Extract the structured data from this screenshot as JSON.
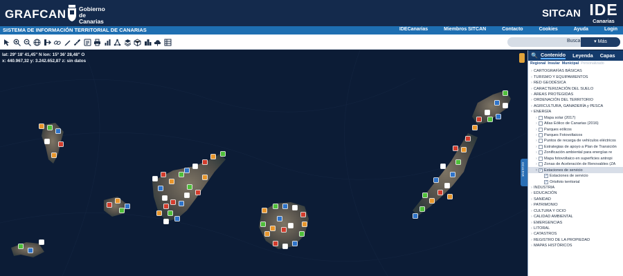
{
  "header": {
    "brand": "GRAFCAN",
    "gov_line1": "Gobierno",
    "gov_line2": "de Canarias",
    "sitcan": "SITCAN",
    "ide_big": "IDE",
    "ide_small": "Canarias"
  },
  "nav": {
    "title": "SISTEMA DE INFORMACIÓN TERRITORIAL DE CANARIAS",
    "links": [
      "IDECanarias",
      "Miembros SITCAN",
      "Contacto",
      "Cookies",
      "Ayuda",
      "Login"
    ]
  },
  "toolbar": {
    "tools": [
      "select-icon",
      "zoom-in-icon",
      "zoom-out-icon",
      "globe-icon",
      "exit-icon",
      "link-icon",
      "draw-icon",
      "measure-icon",
      "info-icon",
      "print-icon",
      "chart-icon",
      "network-icon",
      "layers-icon",
      "cube-icon",
      "city-icon",
      "cloud-icon",
      "table-icon"
    ]
  },
  "search": {
    "button": "Buscar",
    "more": "▾ Más"
  },
  "map": {
    "coord_line1": "lat: 29º 18' 41,45\" N  lon: 15º 36' 28,48\" O",
    "coord_line2": "x: 440.967,32  y: 3.242.652,87  z: sin datos",
    "side_tab": "OCULTAR"
  },
  "panel": {
    "tabs": [
      "Contenido",
      "Leyenda",
      "Capas"
    ],
    "subtabs": [
      "Regional",
      "Insular",
      "Municipal",
      "Personalizado"
    ],
    "tree": [
      {
        "label": "CARTOGRAFÍAS BÁSICAS",
        "level": 0
      },
      {
        "label": "TURISMO Y EQUIPAMIENTOS",
        "level": 0
      },
      {
        "label": "RED GEODÉSICA",
        "level": 0
      },
      {
        "label": "CARACTERIZACIÓN DEL SUELO",
        "level": 0
      },
      {
        "label": "ÁREAS PROTEGIDAS",
        "level": 0
      },
      {
        "label": "ORDENACIÓN DEL TERRITORIO",
        "level": 0
      },
      {
        "label": "AGRICULTURA, GANADERÍA y PESCA",
        "level": 0
      },
      {
        "label": "ENERGÍA",
        "level": 0,
        "open": true
      },
      {
        "label": "Mapa solar (2017)",
        "level": 1
      },
      {
        "label": "Atlas Eólico de Canarias (2016)",
        "level": 1
      },
      {
        "label": "Parques eólicos",
        "level": 1
      },
      {
        "label": "Parques Fotovoltaicos",
        "level": 1
      },
      {
        "label": "Puntos de recarga de vehículos eléctricos",
        "level": 1
      },
      {
        "label": "Estrategias de apoyo a Plan de Transición",
        "level": 1
      },
      {
        "label": "Zonificación ambiental para energías re",
        "level": 1
      },
      {
        "label": "Mapa fotovoltaico en superficies antropi",
        "level": 1
      },
      {
        "label": "Zonas de Aceleración de Renovables (ZA",
        "level": 1
      },
      {
        "label": "Estaciones de servicio",
        "level": 1,
        "checked": true,
        "highlight": true,
        "open": true
      },
      {
        "label": "Estaciones de servicio",
        "level": 2,
        "checked": true
      },
      {
        "label": "Ortofoto territorial",
        "level": 2,
        "checked": true
      },
      {
        "label": "INDUSTRIA",
        "level": 0
      },
      {
        "label": "EDUCACIÓN",
        "level": 0
      },
      {
        "label": "SANIDAD",
        "level": 0
      },
      {
        "label": "PATRIMONIO",
        "level": 0
      },
      {
        "label": "CULTURA Y OCIO",
        "level": 0
      },
      {
        "label": "CALIDAD AMBIENTAL",
        "level": 0
      },
      {
        "label": "EMERGENCIAS",
        "level": 0
      },
      {
        "label": "LITORAL",
        "level": 0
      },
      {
        "label": "CATASTROS",
        "level": 0
      },
      {
        "label": "REGISTRO DE LA PROPIEDAD",
        "level": 0
      },
      {
        "label": "MAPAS HISTÓRICOS",
        "level": 0
      }
    ]
  },
  "colors": {
    "header_bg": "#142a4c",
    "nav_bg": "#1e6fb2",
    "panel_tab_bg": "#133a6b",
    "map_sea": "#0c1c36",
    "marker_orange": "#e8962c",
    "marker_green": "#4fbf3a",
    "marker_blue": "#2e73c9"
  }
}
